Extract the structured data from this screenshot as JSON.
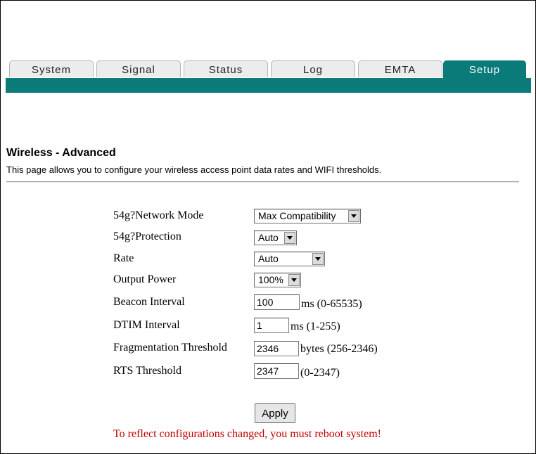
{
  "nav": {
    "tabs": [
      {
        "label": "System"
      },
      {
        "label": "Signal"
      },
      {
        "label": "Status"
      },
      {
        "label": "Log"
      },
      {
        "label": "EMTA"
      },
      {
        "label": "Setup",
        "active": true
      }
    ]
  },
  "colors": {
    "accent": "#0a7b78",
    "warning": "#c00000"
  },
  "page": {
    "title": "Wireless - Advanced",
    "description": "This page allows you to configure your wireless access point data rates and WIFI thresholds."
  },
  "form": {
    "network_mode": {
      "label": "54g?Network Mode",
      "value": "Max Compatibility"
    },
    "protection": {
      "label": "54g?Protection",
      "value": "Auto"
    },
    "rate": {
      "label": "Rate",
      "value": "Auto"
    },
    "output_power": {
      "label": "Output Power",
      "value": "100%"
    },
    "beacon_interval": {
      "label": "Beacon Interval",
      "value": "100",
      "unit": "ms (0-65535)"
    },
    "dtim_interval": {
      "label": "DTIM Interval",
      "value": "1",
      "unit": "ms (1-255)"
    },
    "fragmentation_threshold": {
      "label": "Fragmentation Threshold",
      "value": "2346",
      "unit": "bytes (256-2346)"
    },
    "rts_threshold": {
      "label": "RTS Threshold",
      "value": "2347",
      "unit": "(0-2347)"
    },
    "apply_label": "Apply",
    "reboot_warning": "To reflect configurations changed, you must reboot system!"
  }
}
